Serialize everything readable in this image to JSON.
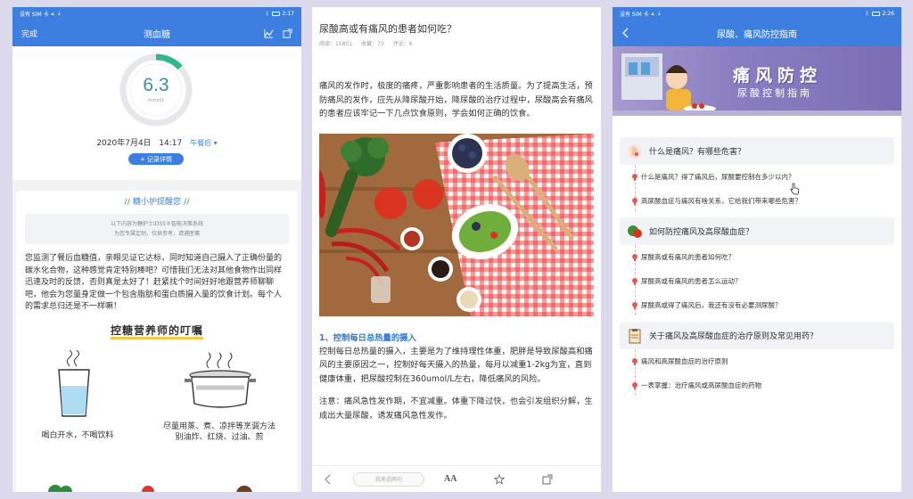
{
  "status_bar": {
    "carrier": "没有 SIM 卡",
    "time_left": "2:17",
    "time_right": "2:26"
  },
  "screen_glucose": {
    "done_label": "完成",
    "title": "测血糖",
    "reading": {
      "value": "6.3",
      "unit": "mmol/L",
      "ring_fraction": 0.13
    },
    "date": "2020年7月4日",
    "time": "14:17",
    "meal_period": "午餐后",
    "record_button": "+ 记录详情",
    "remind_title": "糖小护提醒您",
    "notice_line1": "以下内容为糖护士IDSS®智能决策系统",
    "notice_line2": "为您专属定制，仅供参考，请遵医嘱",
    "remind_body": "您监测了餐后血糖值，亲眼见证它达标，同时知道自己摄入了正确份量的碳水化合物，这种感觉肯定特别棒吧？可惜我们无法对其他食物作出同样迅速及时的反馈，否则真是太好了！赶紧找个时间好好地跟营养师聊聊吧，他会为您量身定做一个包含脂肪和蛋白质摄入量的饮食计划。每个人的需求总归还是不一样嘛！",
    "diet_heading": "控糖营养师的叮嘱",
    "diet_items": [
      {
        "line1": "喝白开水，不喝饮料",
        "line2": ""
      },
      {
        "line1": "尽量用蒸、煮、凉拌等烹调方法",
        "line2": "别油炸、红烧、过油、煎"
      }
    ]
  },
  "screen_article": {
    "title": "尿酸高或有痛风的患者如何吃？",
    "meta": {
      "reads": "阅读：15801",
      "favorites": "收藏：73",
      "comments": "评论：6"
    },
    "intro": "痛风的发作时，极度的痛疼，严重影响患者的生活质量。为了提高生活，预防痛风的发作，应先从降尿酸开始，降尿酸的治疗过程中，尿酸高会有痛风的患者应该牢记一下几点饮食原则，学会如何正确的饮食。",
    "section1_title": "1、控制每日总热量的摄入",
    "section1_body": "控制每日总热量的摄入，主要是为了维持理性体重，肥胖是导致尿酸高和痛风的主要原因之一，控制好每天摄入的热量，每月以减重1-2kg为宜，直到健康体重，把尿酸控制在360umol/L左右，降低痛风的风险。",
    "section1_note": "注意：痛风急性发作期，不宜减重。体重下降过快，也会引发组织分解，生成出大量尿酸，诱发痛风急性发作。",
    "comment_placeholder": "我来说两句",
    "font_button": "AA"
  },
  "screen_guide": {
    "title": "尿酸、痛风防控指南",
    "banner_title": "痛风防控",
    "banner_subtitle": "尿酸控制指南",
    "categories": [
      {
        "label": "什么是痛风？有哪些危害？",
        "icon": "foot-icon",
        "items": [
          "什么是痛风？得了痛风后，尿酸要控制在多少以内？",
          "高尿酸血症与痛风有啥关系，它给我们带来哪些危害？"
        ]
      },
      {
        "label": "如何防控痛风及高尿酸血症？",
        "icon": "vegetable-icon",
        "items": [
          "尿酸高或有痛风的患者如何吃？",
          "尿酸高或有痛风的患者怎么运动？",
          "尿酸高或得了痛风后，我还有没有必要测尿酸？"
        ]
      },
      {
        "label": "关于痛风及高尿酸血症的治疗原则及常见用药？",
        "icon": "clipboard-icon",
        "items": [
          "痛风和高尿酸血症的治疗原则",
          "一表掌握：治疗痛风或高尿酸血症的药物"
        ]
      }
    ]
  },
  "colors": {
    "primary": "#3d7fe0",
    "gauge_green": "#2fb88a",
    "section_title": "#2f7bd6",
    "toc_dot": "#e2585a",
    "banner": "#8b7fc2"
  }
}
